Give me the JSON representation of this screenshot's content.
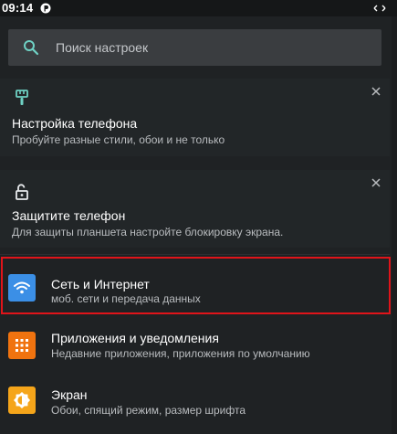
{
  "status_bar": {
    "time": "09:14",
    "icons": [
      "p-icon",
      "rotate-arrows-icon"
    ]
  },
  "search": {
    "placeholder": "Поиск настроек",
    "icon": "search-icon"
  },
  "suggestion_cards": [
    {
      "icon": "paint-brush-icon",
      "title": "Настройка телефона",
      "subtitle": "Пробуйте разные стили, обои и не только"
    },
    {
      "icon": "lock-icon",
      "title": "Защитите телефон",
      "subtitle": "Для защиты планшета настройте блокировку экрана."
    }
  ],
  "settings": [
    {
      "icon": "wifi-icon",
      "title": "Сеть и Интернет",
      "subtitle": "моб. сети и передача данных",
      "highlighted": true
    },
    {
      "icon": "apps-grid-icon",
      "title": "Приложения и уведомления",
      "subtitle": "Недавние приложения, приложения по умолчанию"
    },
    {
      "icon": "brightness-icon",
      "title": "Экран",
      "subtitle": "Обои, спящий режим, размер шрифта"
    }
  ],
  "colors": {
    "background": "#1f2224",
    "accent_teal": "#6fd1c4",
    "highlight": "#e0141a",
    "network_tile": "#3b8fe6",
    "apps_tile": "#f0730f",
    "display_tile": "#f5a51a"
  }
}
